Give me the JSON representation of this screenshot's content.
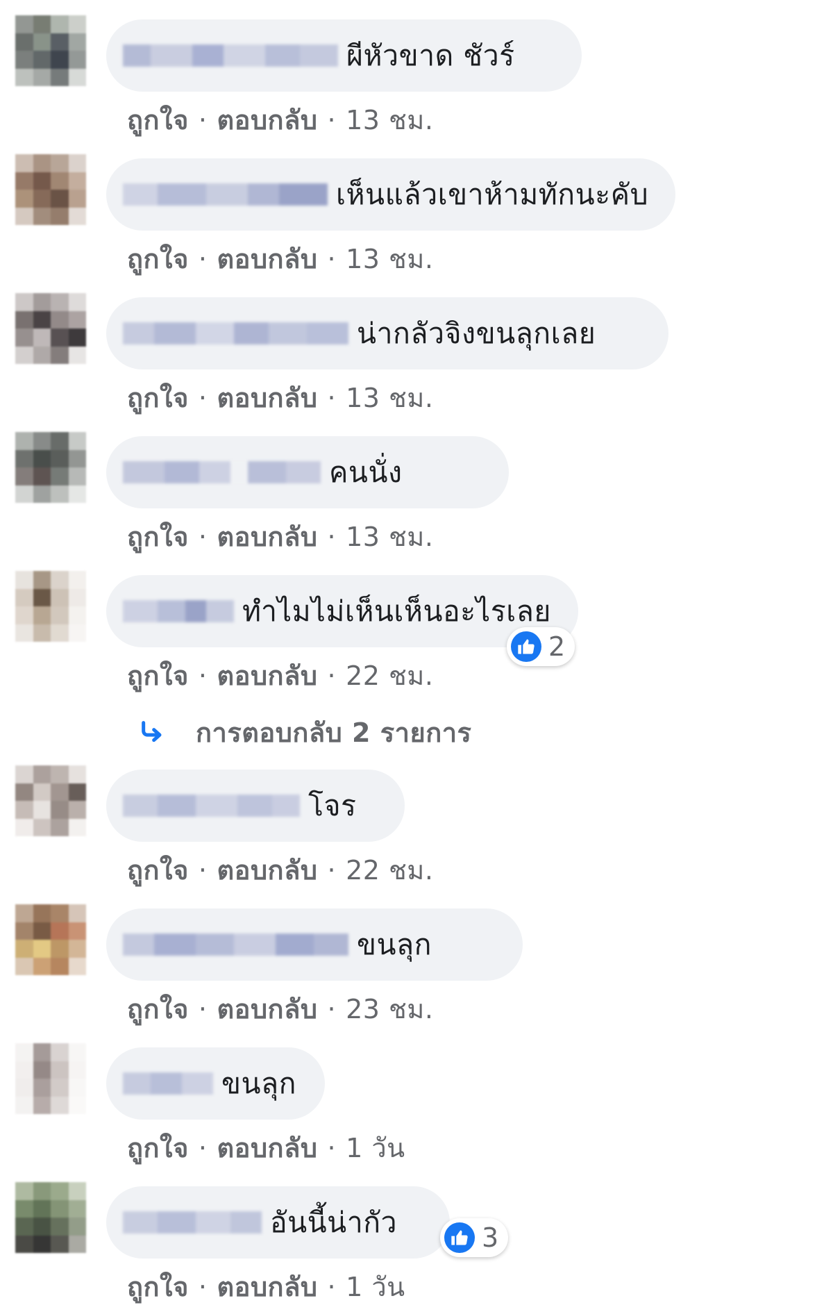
{
  "labels": {
    "like": "ถูกใจ",
    "reply": "ตอบกลับ",
    "separator": "·"
  },
  "colors": {
    "bubble": "#f0f2f5",
    "meta_text": "#65676b",
    "like_blue": "#1877f2"
  },
  "comments": [
    {
      "text": "ผีหัวขาด ชัวร์",
      "time": "13 ชม.",
      "reaction_icon": "like-icon",
      "reactions": null
    },
    {
      "text": "เห็นแล้วเขาห้ามทักนะคับ",
      "time": "13 ชม.",
      "reaction_icon": null,
      "reactions": null
    },
    {
      "text": "น่ากลัวจิงขนลุกเลย",
      "time": "13 ชม.",
      "reaction_icon": null,
      "reactions": null
    },
    {
      "text": "คนนั่ง",
      "time": "13 ชม.",
      "reaction_icon": null,
      "reactions": null
    },
    {
      "text": "ทำไมไม่เห็นเห็นอะไรเลย",
      "time": "22 ชม.",
      "reaction_icon": "like-icon",
      "reactions": "2"
    },
    {
      "text": "โจร",
      "time": "22 ชม.",
      "reaction_icon": null,
      "reactions": null
    },
    {
      "text": "ขนลุก",
      "time": "23 ชม.",
      "reaction_icon": null,
      "reactions": null
    },
    {
      "text": "ขนลุก",
      "time": "1 วัน",
      "reaction_icon": null,
      "reactions": null
    },
    {
      "text": "อันนี้น่ากัว",
      "time": "1 วัน",
      "reaction_icon": "like-icon",
      "reactions": "3"
    }
  ],
  "replies_link": {
    "icon": "reply-arrow-icon",
    "label": "การตอบกลับ 2 รายการ"
  }
}
